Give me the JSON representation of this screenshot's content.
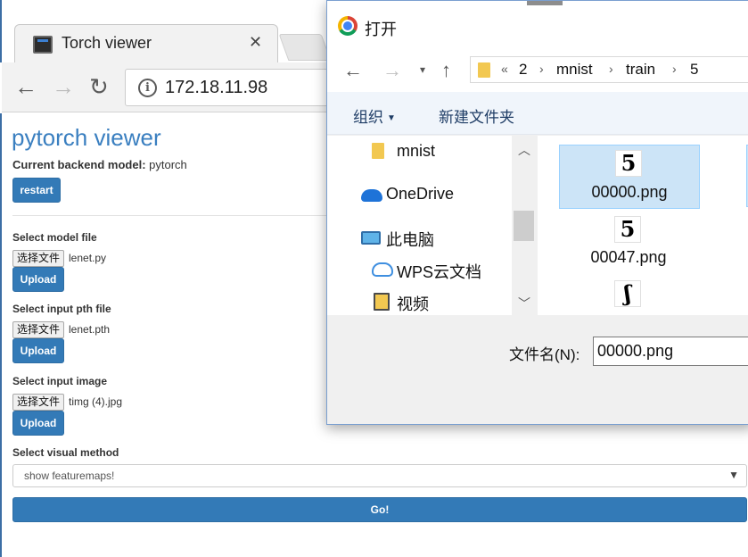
{
  "browser": {
    "tab_title": "Torch viewer",
    "tab_close": "✕",
    "url": "172.18.11.98",
    "nav_back": "←",
    "nav_forward": "→",
    "reload": "↻"
  },
  "page": {
    "title": "pytorch viewer",
    "backend_label": "Current backend model:",
    "backend_value": "pytorch",
    "restart_label": "restart",
    "sections": [
      {
        "label": "Select model file",
        "choose_label": "选择文件",
        "file": "lenet.py",
        "upload_label": "Upload"
      },
      {
        "label": "Select input pth file",
        "choose_label": "选择文件",
        "file": "lenet.pth",
        "upload_label": "Upload"
      },
      {
        "label": "Select input image",
        "choose_label": "选择文件",
        "file": "timg (4).jpg",
        "upload_label": "Upload"
      }
    ],
    "visual_label": "Select visual method",
    "visual_selected": "show featuremaps!",
    "go_label": "Go!"
  },
  "dialog": {
    "title": "打开",
    "path_prefix": "«",
    "path": [
      "2",
      "mnist",
      "train",
      "5"
    ],
    "organize_label": "组织",
    "new_folder_label": "新建文件夹",
    "nav_items": [
      {
        "label": "mnist",
        "icon": "folder-icon"
      },
      {
        "label": "OneDrive",
        "icon": "onedrive-cloud-icon"
      },
      {
        "label": "此电脑",
        "icon": "computer-icon"
      },
      {
        "label": "WPS云文档",
        "icon": "wps-cloud-icon"
      },
      {
        "label": "视频",
        "icon": "video-folder-icon"
      }
    ],
    "files": [
      {
        "name": "00000.png",
        "glyph": "5"
      },
      {
        "name": "00047.png",
        "glyph": "5"
      },
      {
        "glyph": "ʃ"
      }
    ],
    "filename_label": "文件名(N):",
    "filename_value": "00000.png"
  },
  "colors": {
    "primary": "#337ab7",
    "title_blue": "#3a7fc0",
    "selection": "#cce4f7"
  }
}
